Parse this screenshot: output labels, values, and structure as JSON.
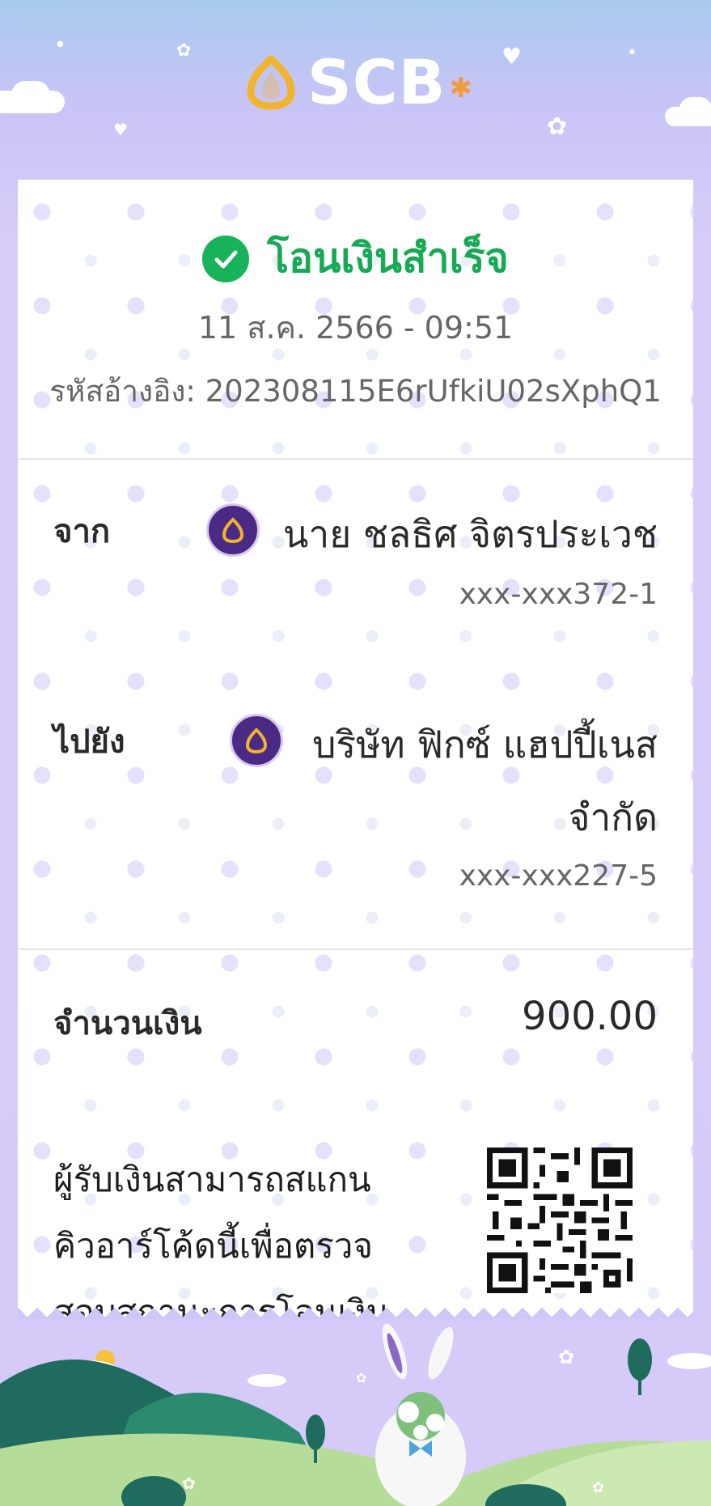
{
  "brand": {
    "name": "SCB",
    "logo_icon": "scb-logo-icon"
  },
  "receipt": {
    "status": "โอนเงินสำเร็จ",
    "datetime": "11 ส.ค. 2566 - 09:51",
    "reference": "รหัสอ้างอิง: 202308115E6rUfkiU02sXphQ1",
    "from": {
      "label": "จาก",
      "name": "นาย ชลธิศ จิตรประเวช",
      "account": "xxx-xxx372-1"
    },
    "to": {
      "label": "ไปยัง",
      "name_line1": "บริษัท ฟิกซ์ แฮปปี้เนส",
      "name_line2": "จำกัด",
      "account": "xxx-xxx227-5"
    },
    "amount": {
      "label": "จำนวนเงิน",
      "value": "900.00"
    },
    "qr_note": {
      "line1": "ผู้รับเงินสามารถสแกน",
      "line2": "คิวอาร์โค้ดนี้เพื่อตรวจ",
      "line3": "สอบสถานะการโอนเงิน"
    }
  },
  "colors": {
    "success": "#18b25a",
    "brand_purple": "#4b2a85",
    "brand_gold": "#f2b32d"
  }
}
